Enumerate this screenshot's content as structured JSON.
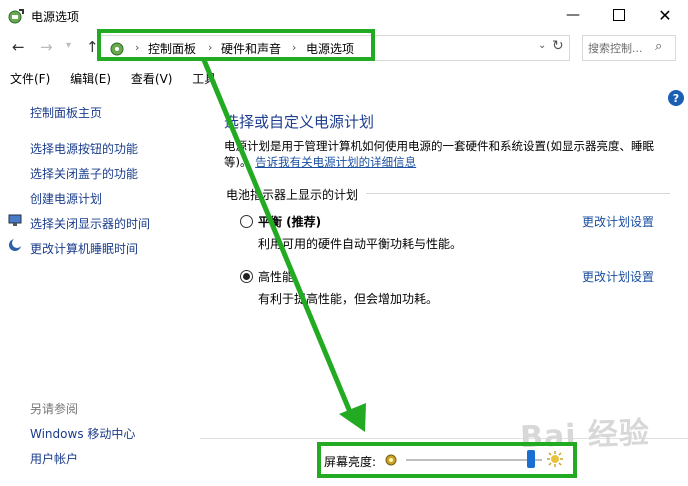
{
  "window": {
    "title": "电源选项"
  },
  "address": {
    "crumbs": [
      "控制面板",
      "硬件和声音",
      "电源选项"
    ]
  },
  "search": {
    "placeholder": "搜索控制..."
  },
  "menu": [
    "文件(F)",
    "编辑(E)",
    "查看(V)",
    "工具"
  ],
  "left": {
    "home": "控制面板主页",
    "items": [
      "选择电源按钮的功能",
      "选择关闭盖子的功能",
      "创建电源计划",
      "选择关闭显示器的时间",
      "更改计算机睡眠时间"
    ],
    "see_also_label": "另请参阅",
    "see_also": [
      "Windows 移动中心",
      "用户帐户"
    ]
  },
  "main": {
    "title": "选择或自定义电源计划",
    "desc_line1": "电源计划是用于管理计算机如何使用电源的一套硬件和系统设置(如显示器亮度、睡眠",
    "desc_line2_prefix": "等)。",
    "desc_link": "告诉我有关电源计划的详细信息",
    "section_label": "电池指示器上显示的计划",
    "plans": [
      {
        "name": "平衡 (推荐)",
        "desc": "利用可用的硬件自动平衡功耗与性能。",
        "link": "更改计划设置",
        "selected": false
      },
      {
        "name": "高性能",
        "desc": "有利于提高性能，但会增加功耗。",
        "link": "更改计划设置",
        "selected": true
      }
    ]
  },
  "brightness": {
    "label": "屏幕亮度:",
    "level_percent": 92
  },
  "watermark": "Bai 经验",
  "colors": {
    "annotation_green": "#22aa22",
    "link_blue": "#1a4fa0"
  }
}
